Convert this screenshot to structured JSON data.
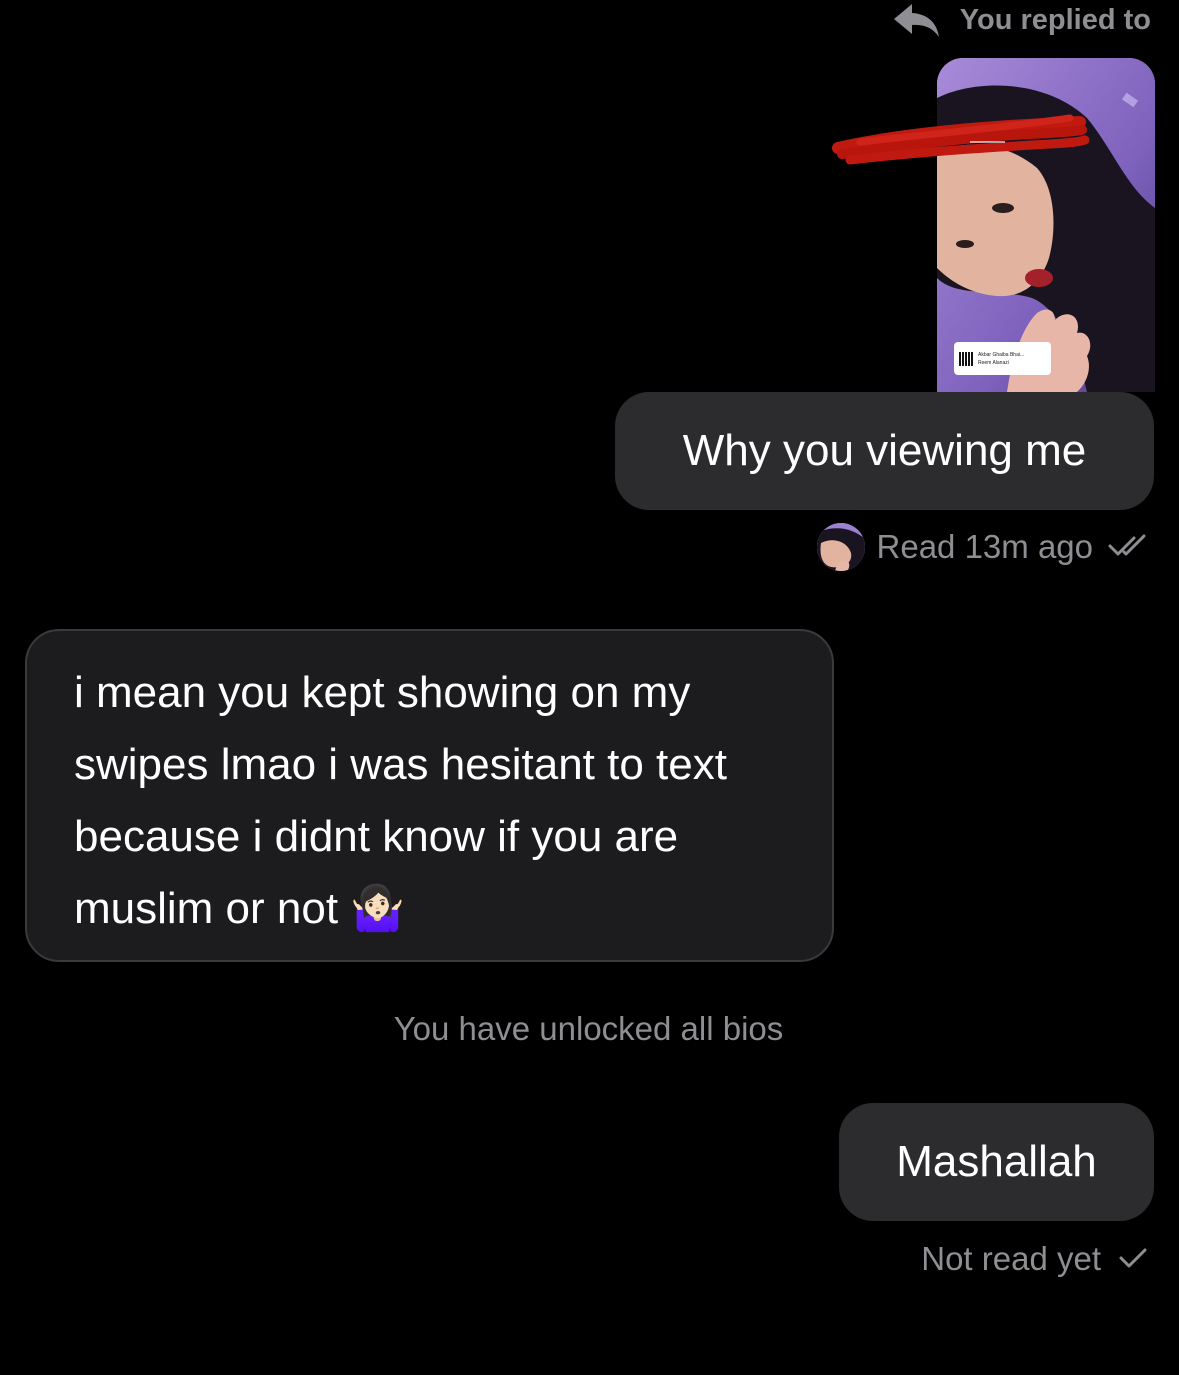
{
  "reply_header": {
    "label": "You replied to",
    "icon": "reply-arrow-icon"
  },
  "story": {
    "sticker_title": "Akbar Ghaiba Bhai...",
    "sticker_subtitle": "Reem Alanazi"
  },
  "messages": [
    {
      "direction": "outgoing",
      "text": "Why you viewing me",
      "status": "Read 13m ago",
      "status_icon": "double-check-icon"
    },
    {
      "direction": "incoming",
      "text": "i mean you kept showing on my swipes lmao i was hesitant to text because i didnt know if you are muslim or not 🤷🏻‍♀️"
    },
    {
      "direction": "outgoing",
      "text": "Mashallah",
      "status": "Not read yet",
      "status_icon": "single-check-icon"
    }
  ],
  "system_message": "You have unlocked all bios",
  "colors": {
    "background": "#000000",
    "outgoing_bubble": "#2c2c2e",
    "incoming_bubble": "#1c1c1e",
    "incoming_border": "#3a3a3c",
    "secondary_text": "#8e8e93",
    "redaction": "#c01a10"
  }
}
